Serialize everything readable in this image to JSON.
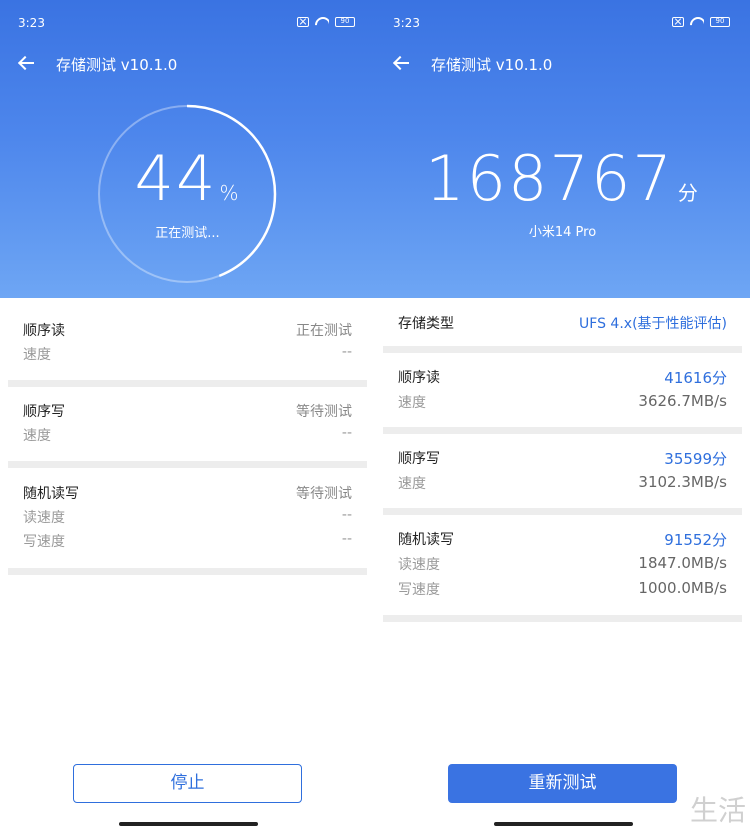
{
  "left": {
    "status_time": "3:23",
    "battery": "90",
    "title": "存储测试 v10.1.0",
    "progress": {
      "value": 0.44,
      "number": "44",
      "unit": "%",
      "status": "正在测试..."
    },
    "sections": [
      {
        "name": "顺序读",
        "state": "正在测试",
        "rows": [
          {
            "label": "速度",
            "value": "--"
          }
        ]
      },
      {
        "name": "顺序写",
        "state": "等待测试",
        "rows": [
          {
            "label": "速度",
            "value": "--"
          }
        ]
      },
      {
        "name": "随机读写",
        "state": "等待测试",
        "rows": [
          {
            "label": "读速度",
            "value": "--"
          },
          {
            "label": "写速度",
            "value": "--"
          }
        ]
      }
    ],
    "button": "停止"
  },
  "right": {
    "status_time": "3:23",
    "battery": "90",
    "title": "存储测试 v10.1.0",
    "score": {
      "number": "168767",
      "unit": "分"
    },
    "device": "小米14 Pro",
    "storage_type": {
      "label": "存储类型",
      "value": "UFS 4.x(基于性能评估)"
    },
    "sections": [
      {
        "name": "顺序读",
        "score": "41616分",
        "rows": [
          {
            "label": "速度",
            "value": "3626.7MB/s"
          }
        ]
      },
      {
        "name": "顺序写",
        "score": "35599分",
        "rows": [
          {
            "label": "速度",
            "value": "3102.3MB/s"
          }
        ]
      },
      {
        "name": "随机读写",
        "score": "91552分",
        "rows": [
          {
            "label": "读速度",
            "value": "1847.0MB/s"
          },
          {
            "label": "写速度",
            "value": "1000.0MB/s"
          }
        ]
      }
    ],
    "button": "重新测试"
  },
  "watermark": "生活",
  "colors": {
    "accent": "#2f6fdd",
    "header_top": "#3a73e2",
    "header_bottom": "#6ea6f4",
    "separator": "#ededed"
  }
}
